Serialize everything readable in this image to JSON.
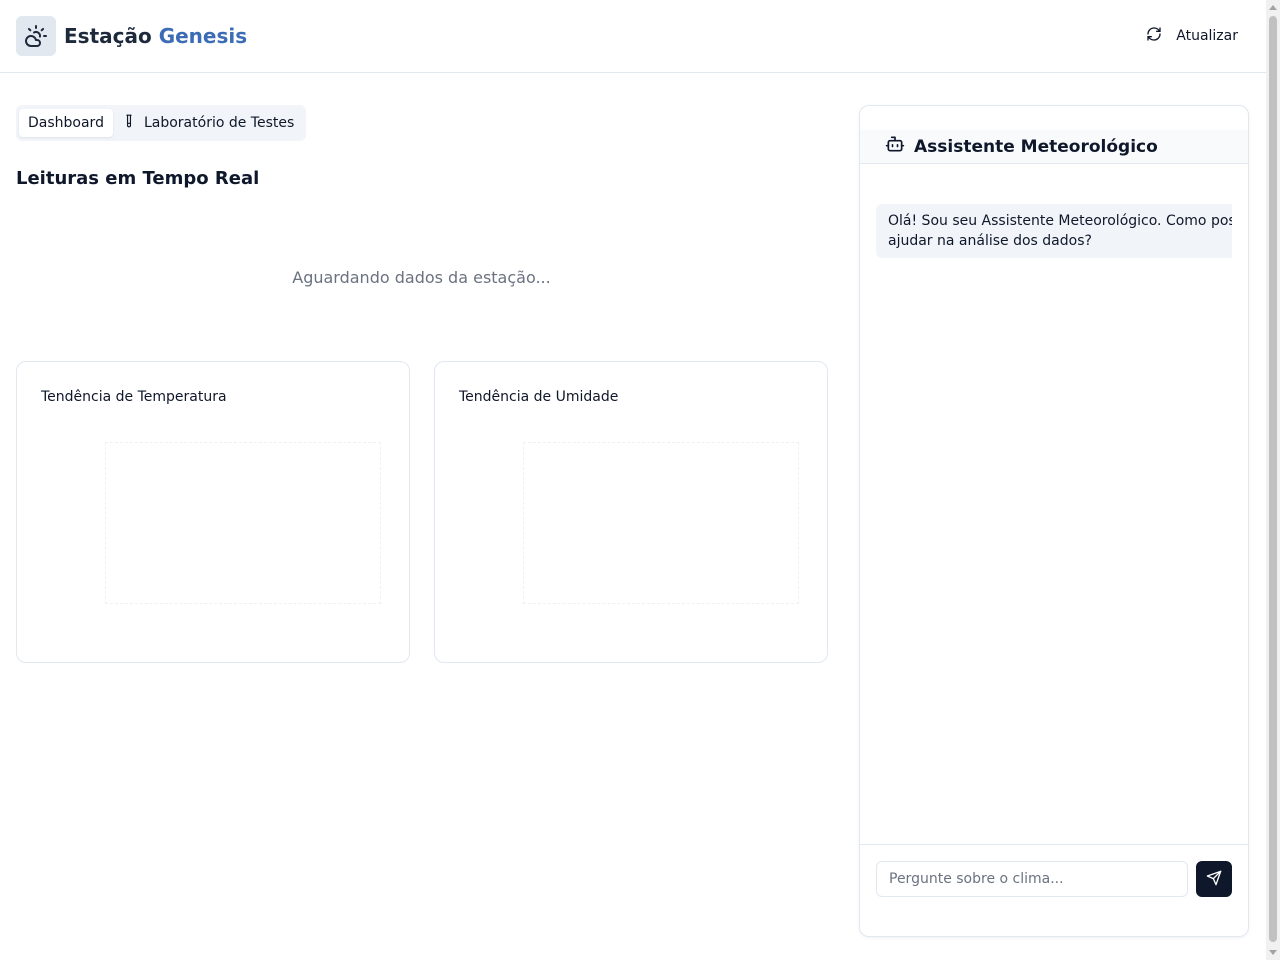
{
  "header": {
    "brand_prefix": "Estação",
    "brand_accent": "Genesis",
    "logo_icon": "cloud-sun-icon",
    "refresh_label": "Atualizar",
    "refresh_icon": "refresh-icon"
  },
  "tabs": [
    {
      "label": "Dashboard",
      "active": true
    },
    {
      "label": "Laboratório de Testes",
      "icon": "flask-icon",
      "active": false
    }
  ],
  "main": {
    "section_title": "Leituras em Tempo Real",
    "waiting_text": "Aguardando dados da estação..."
  },
  "charts": [
    {
      "title": "Tendência de Temperatura"
    },
    {
      "title": "Tendência de Umidade"
    }
  ],
  "assistant": {
    "title": "Assistente Meteorológico",
    "icon": "bot-icon",
    "messages": [
      {
        "role": "assistant",
        "text": "Olá! Sou seu Assistente Meteorológico. Como posso ajudar na análise dos dados?"
      }
    ],
    "input_placeholder": "Pergunte sobre o clima...",
    "send_icon": "send-icon"
  },
  "colors": {
    "accent": "#3b6cb5",
    "primary": "#0f172a",
    "muted": "#6b7280",
    "border": "#e2e8f0"
  }
}
